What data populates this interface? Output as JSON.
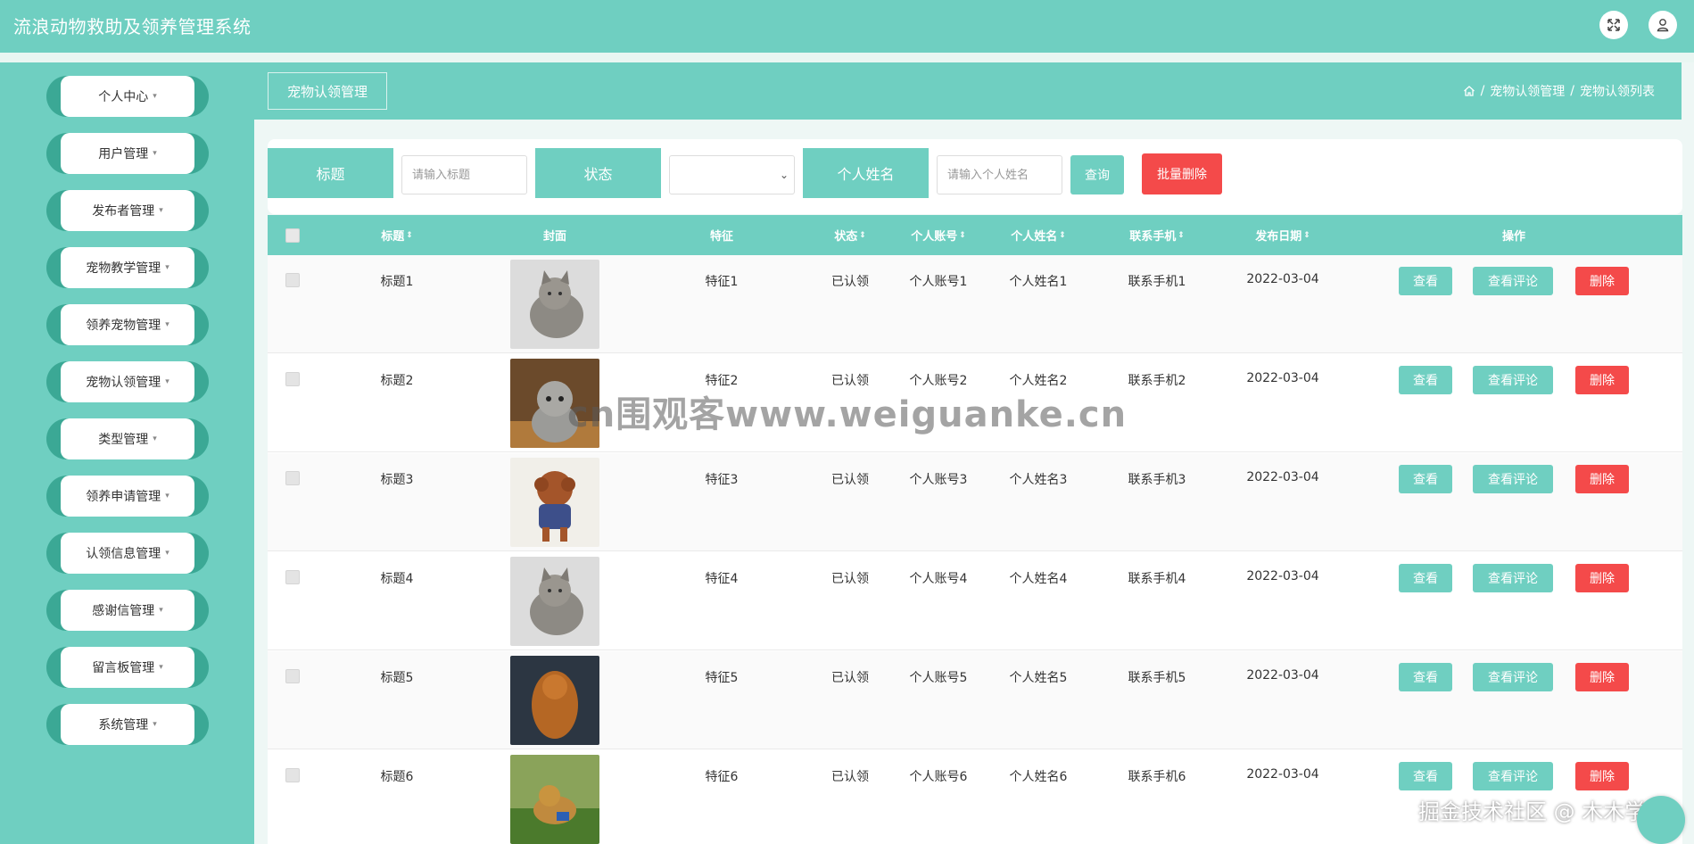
{
  "header": {
    "title": "流浪动物救助及领养管理系统",
    "fullscreen_icon": "expand-arrows-icon",
    "user_icon": "user-icon"
  },
  "sidebar": {
    "items": [
      {
        "label": "个人中心"
      },
      {
        "label": "用户管理"
      },
      {
        "label": "发布者管理"
      },
      {
        "label": "宠物教学管理"
      },
      {
        "label": "领养宠物管理"
      },
      {
        "label": "宠物认领管理"
      },
      {
        "label": "类型管理"
      },
      {
        "label": "领养申请管理"
      },
      {
        "label": "认领信息管理"
      },
      {
        "label": "感谢信管理"
      },
      {
        "label": "留言板管理"
      },
      {
        "label": "系统管理"
      }
    ]
  },
  "page": {
    "tab": "宠物认领管理",
    "breadcrumb": [
      "宠物认领管理",
      "宠物认领列表"
    ],
    "breadcrumb_sep": "/"
  },
  "search": {
    "title_label": "标题",
    "title_placeholder": "请输入标题",
    "status_label": "状态",
    "status_value": "",
    "name_label": "个人姓名",
    "name_placeholder": "请输入个人姓名",
    "query_button": "查询",
    "batch_delete_button": "批量删除"
  },
  "table": {
    "columns": [
      "标题",
      "封面",
      "特征",
      "状态",
      "个人账号",
      "个人姓名",
      "联系手机",
      "发布日期",
      "操作"
    ],
    "rows": [
      {
        "title": "标题1",
        "feature": "特征1",
        "status": "已认领",
        "account": "个人账号1",
        "name": "个人姓名1",
        "phone": "联系手机1",
        "date": "2022-03-04",
        "cover": "gray-tabby-cat"
      },
      {
        "title": "标题2",
        "feature": "特征2",
        "status": "已认领",
        "account": "个人账号2",
        "name": "个人姓名2",
        "phone": "联系手机2",
        "date": "2022-03-04",
        "cover": "scottish-fold-kitten"
      },
      {
        "title": "标题3",
        "feature": "特征3",
        "status": "已认领",
        "account": "个人账号3",
        "name": "个人姓名3",
        "phone": "联系手机3",
        "date": "2022-03-04",
        "cover": "poodle-in-sweater"
      },
      {
        "title": "标题4",
        "feature": "特征4",
        "status": "已认领",
        "account": "个人账号4",
        "name": "个人姓名4",
        "phone": "联系手机4",
        "date": "2022-03-04",
        "cover": "gray-tabby-cat"
      },
      {
        "title": "标题5",
        "feature": "特征5",
        "status": "已认领",
        "account": "个人账号5",
        "name": "个人姓名5",
        "phone": "联系手机5",
        "date": "2022-03-04",
        "cover": "long-haired-dog"
      },
      {
        "title": "标题6",
        "feature": "特征6",
        "status": "已认领",
        "account": "个人账号6",
        "name": "个人姓名6",
        "phone": "联系手机6",
        "date": "2022-03-04",
        "cover": "puppy-on-grass"
      }
    ],
    "actions": {
      "view": "查看",
      "comments": "查看评论",
      "delete": "删除"
    }
  },
  "overlay": {
    "watermark": "cn围观客www.weiguanke.cn",
    "corner_text": "掘金技术社区 @ 木木学长"
  },
  "colors": {
    "primary": "#6fcfc1",
    "danger": "#f44a4a",
    "sidebar_accent": "#3ba895"
  }
}
